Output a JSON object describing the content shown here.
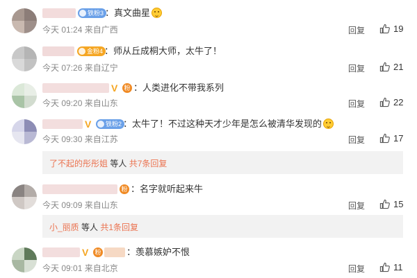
{
  "comments": [
    {
      "badge": "铁粉3",
      "badge_color": "#6aa0e8",
      "text": "：真文曲星",
      "time": "今天 01:24",
      "location": "来自广西",
      "reply": "回复",
      "likes": "19"
    },
    {
      "badge": "金粉4",
      "badge_color": "#f5a623",
      "text": "：师从丘成桐大师，太牛了！",
      "time": "今天 07:26",
      "location": "来自辽宁",
      "reply": "回复",
      "likes": "21"
    },
    {
      "badge": "",
      "text": "：人类进化不带我系列",
      "time": "今天 09:20",
      "location": "来自山东",
      "reply": "回复",
      "likes": "22"
    },
    {
      "badge": "铁粉2",
      "badge_color": "#6aa0e8",
      "text": "：太牛了！不过这种天才少年是怎么被清华发现的",
      "time": "今天 09:30",
      "location": "来自江苏",
      "reply": "回复",
      "likes": "17",
      "sub": {
        "user": "了不起的彤彤姐",
        "mid": " 等人 ",
        "total": "共7条回复"
      }
    },
    {
      "badge": "",
      "text": "：名字就听起来牛",
      "time": "今天 09:09",
      "location": "来自山东",
      "reply": "回复",
      "likes": "15",
      "sub": {
        "user": "小_丽质",
        "mid": " 等人 ",
        "total": "共1条回复"
      }
    },
    {
      "badge": "",
      "text": "：羡慕嫉妒不恨",
      "time": "今天 09:01",
      "location": "来自北京",
      "reply": "回复",
      "likes": "11"
    }
  ],
  "icons": {
    "like": "thumbs-up-icon",
    "fan": "fan-club-icon",
    "verified": "verified-v-icon",
    "emoji": "laughing-emoji-icon"
  },
  "colors": {
    "link": "#eb7350",
    "meta": "#888888",
    "subbox": "#f2f2f2",
    "badge_iron": "#6aa0e8",
    "badge_gold": "#f5a623"
  }
}
